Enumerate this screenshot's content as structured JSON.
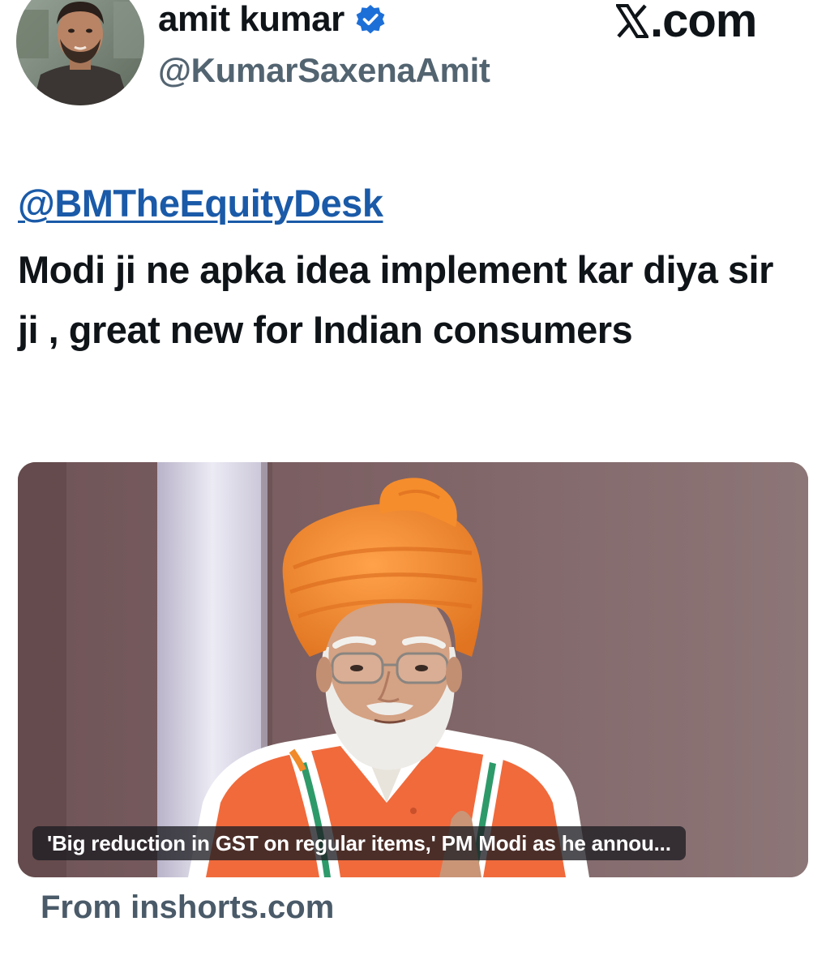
{
  "post": {
    "author": {
      "display_name": "amit kumar",
      "handle": "@KumarSaxenaAmit",
      "verified_icon": "verified-badge-icon",
      "avatar_icon": "profile-photo"
    },
    "brand_label": ".com",
    "mention": "@BMTheEquityDesk",
    "text": "Modi ji ne apka idea implement kar diya sir ji , great new for Indian consumers",
    "media": {
      "caption": "'Big reduction in GST on regular items,' PM Modi as he annou...",
      "image_icon": "news-photo"
    },
    "source": "From inshorts.com"
  },
  "colors": {
    "text": "#0f1419",
    "handle": "#536471",
    "mention": "#1a5aa8",
    "verified": "#1d6fd8",
    "source": "#4a5a68",
    "turban": "#f08a2a",
    "vest": "#f06a3c"
  }
}
